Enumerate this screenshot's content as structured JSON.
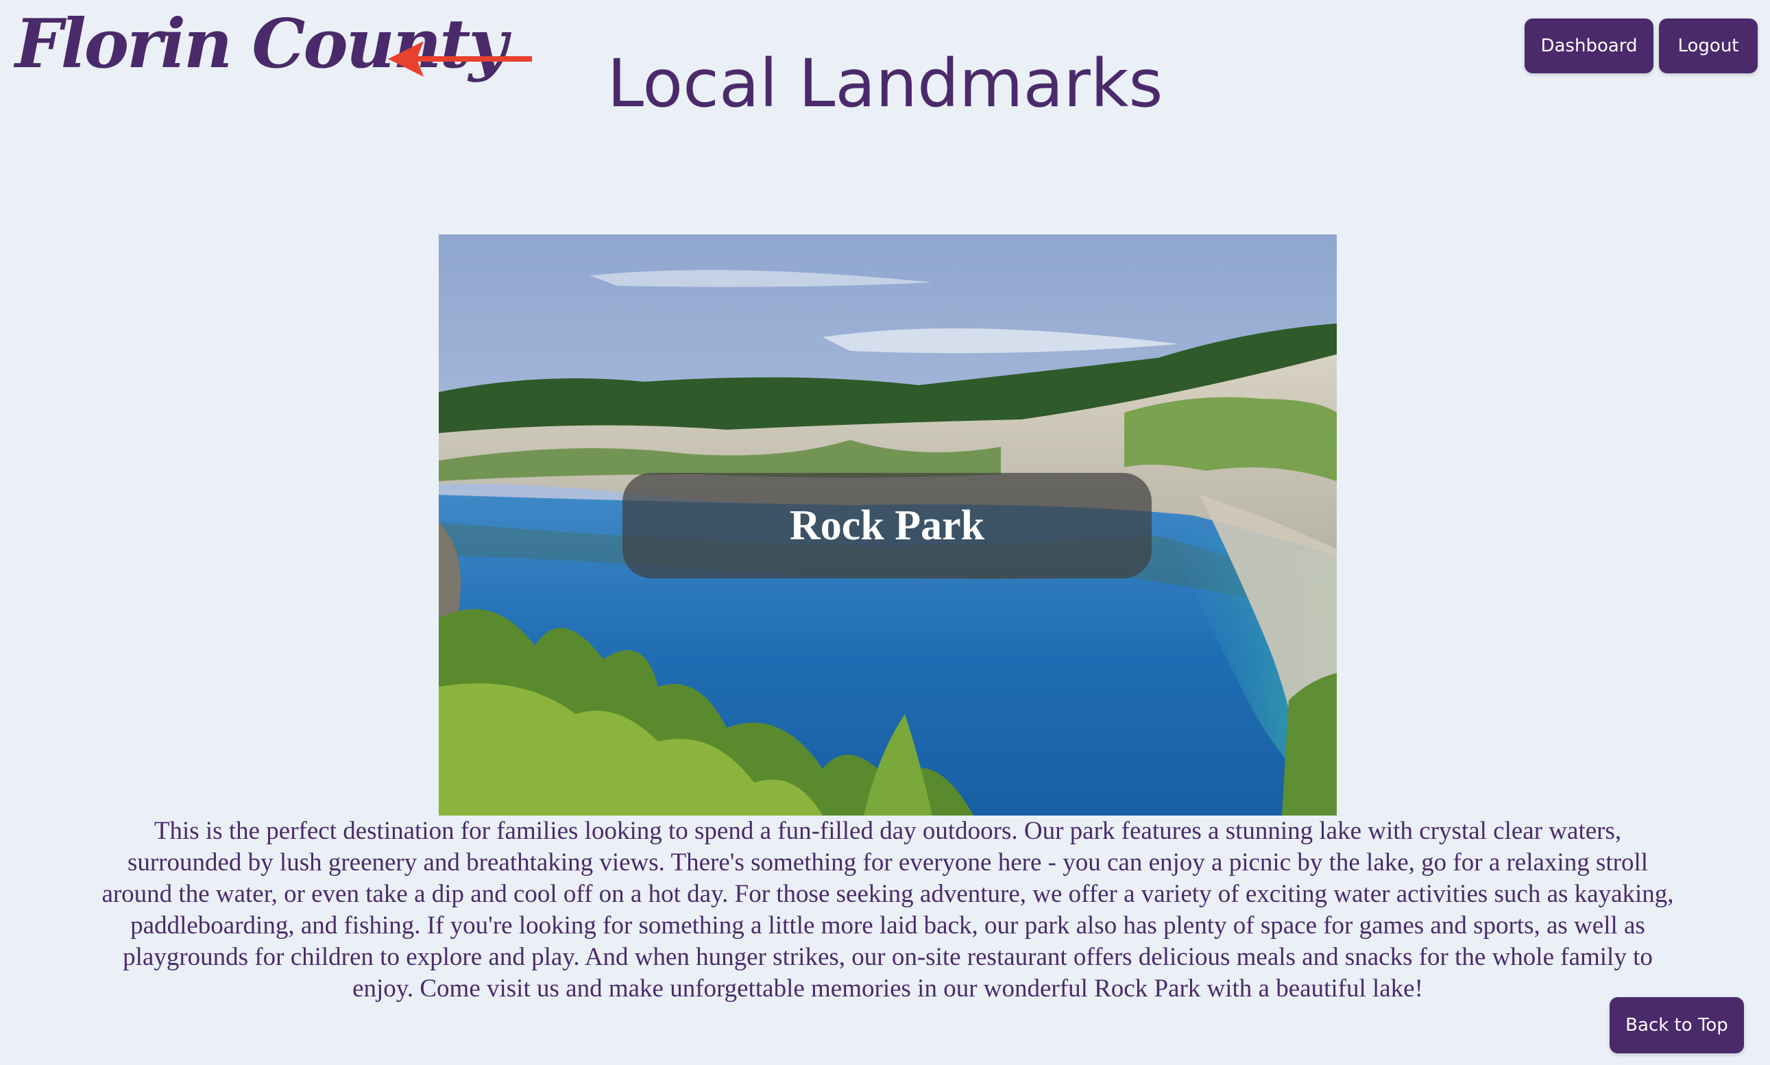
{
  "header": {
    "logo": "Florin County",
    "page_title": "Local Landmarks",
    "dashboard_label": "Dashboard",
    "logout_label": "Logout"
  },
  "landmark": {
    "name": "Rock Park",
    "description": "This is the perfect destination for families looking to spend a fun-filled day outdoors. Our park features a stunning lake with crystal clear waters, surrounded by lush greenery and breathtaking views. There's something for everyone here - you can enjoy a picnic by the lake, go for a relaxing stroll around the water, or even take a dip and cool off on a hot day. For those seeking adventure, we offer a variety of exciting water activities such as kayaking, paddleboarding, and fishing. If you're looking for something a little more laid back, our park also has plenty of space for games and sports, as well as playgrounds for children to explore and play. And when hunger strikes, our on-site restaurant offers delicious meals and snacks for the whole family to enjoy. Come visit us and make unforgettable memories in our wonderful Rock Park with a beautiful lake!"
  },
  "footer": {
    "back_to_top_label": "Back to Top"
  },
  "icons": {
    "annotation": "left-arrow-icon"
  },
  "colors": {
    "brand": "#4b2a6b",
    "background": "#eaf0f6",
    "arrow": "#e8412e"
  }
}
